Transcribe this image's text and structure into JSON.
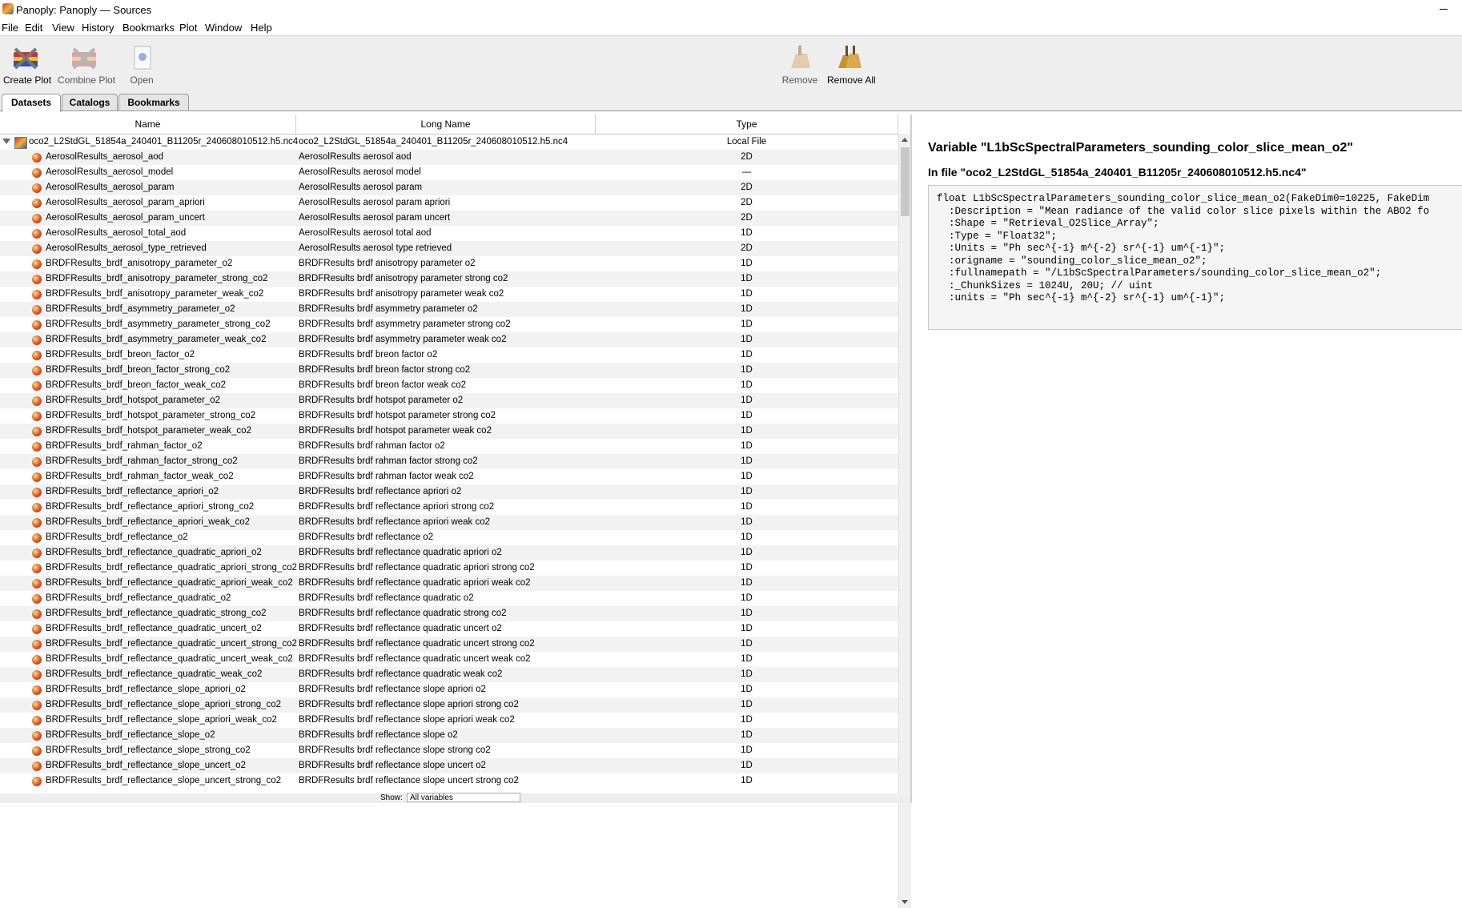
{
  "window": {
    "title": "Panoply: Panoply — Sources"
  },
  "menu": [
    "File",
    "Edit",
    "View",
    "History",
    "Bookmarks",
    "Plot",
    "Window",
    "Help"
  ],
  "toolbar": {
    "create_plot": "Create Plot",
    "combine_plot": "Combine Plot",
    "open": "Open",
    "remove": "Remove",
    "remove_all": "Remove All"
  },
  "tabs": [
    "Datasets",
    "Catalogs",
    "Bookmarks"
  ],
  "table": {
    "headers": [
      "Name",
      "Long Name",
      "Type"
    ],
    "root": {
      "name": "oco2_L2StdGL_51854a_240401_B11205r_240608010512.h5.nc4",
      "long_name": "oco2_L2StdGL_51854a_240401_B11205r_240608010512.h5.nc4",
      "type": "Local File"
    },
    "rows": [
      {
        "name": "AerosolResults_aerosol_aod",
        "long_name": "AerosolResults aerosol aod",
        "type": "2D"
      },
      {
        "name": "AerosolResults_aerosol_model",
        "long_name": "AerosolResults aerosol model",
        "type": "—"
      },
      {
        "name": "AerosolResults_aerosol_param",
        "long_name": "AerosolResults aerosol param",
        "type": "2D"
      },
      {
        "name": "AerosolResults_aerosol_param_apriori",
        "long_name": "AerosolResults aerosol param apriori",
        "type": "2D"
      },
      {
        "name": "AerosolResults_aerosol_param_uncert",
        "long_name": "AerosolResults aerosol param uncert",
        "type": "2D"
      },
      {
        "name": "AerosolResults_aerosol_total_aod",
        "long_name": "AerosolResults aerosol total aod",
        "type": "1D"
      },
      {
        "name": "AerosolResults_aerosol_type_retrieved",
        "long_name": "AerosolResults aerosol type retrieved",
        "type": "2D"
      },
      {
        "name": "BRDFResults_brdf_anisotropy_parameter_o2",
        "long_name": "BRDFResults brdf anisotropy parameter o2",
        "type": "1D"
      },
      {
        "name": "BRDFResults_brdf_anisotropy_parameter_strong_co2",
        "long_name": "BRDFResults brdf anisotropy parameter strong co2",
        "type": "1D"
      },
      {
        "name": "BRDFResults_brdf_anisotropy_parameter_weak_co2",
        "long_name": "BRDFResults brdf anisotropy parameter weak co2",
        "type": "1D"
      },
      {
        "name": "BRDFResults_brdf_asymmetry_parameter_o2",
        "long_name": "BRDFResults brdf asymmetry parameter o2",
        "type": "1D"
      },
      {
        "name": "BRDFResults_brdf_asymmetry_parameter_strong_co2",
        "long_name": "BRDFResults brdf asymmetry parameter strong co2",
        "type": "1D"
      },
      {
        "name": "BRDFResults_brdf_asymmetry_parameter_weak_co2",
        "long_name": "BRDFResults brdf asymmetry parameter weak co2",
        "type": "1D"
      },
      {
        "name": "BRDFResults_brdf_breon_factor_o2",
        "long_name": "BRDFResults brdf breon factor o2",
        "type": "1D"
      },
      {
        "name": "BRDFResults_brdf_breon_factor_strong_co2",
        "long_name": "BRDFResults brdf breon factor strong co2",
        "type": "1D"
      },
      {
        "name": "BRDFResults_brdf_breon_factor_weak_co2",
        "long_name": "BRDFResults brdf breon factor weak co2",
        "type": "1D"
      },
      {
        "name": "BRDFResults_brdf_hotspot_parameter_o2",
        "long_name": "BRDFResults brdf hotspot parameter o2",
        "type": "1D"
      },
      {
        "name": "BRDFResults_brdf_hotspot_parameter_strong_co2",
        "long_name": "BRDFResults brdf hotspot parameter strong co2",
        "type": "1D"
      },
      {
        "name": "BRDFResults_brdf_hotspot_parameter_weak_co2",
        "long_name": "BRDFResults brdf hotspot parameter weak co2",
        "type": "1D"
      },
      {
        "name": "BRDFResults_brdf_rahman_factor_o2",
        "long_name": "BRDFResults brdf rahman factor o2",
        "type": "1D"
      },
      {
        "name": "BRDFResults_brdf_rahman_factor_strong_co2",
        "long_name": "BRDFResults brdf rahman factor strong co2",
        "type": "1D"
      },
      {
        "name": "BRDFResults_brdf_rahman_factor_weak_co2",
        "long_name": "BRDFResults brdf rahman factor weak co2",
        "type": "1D"
      },
      {
        "name": "BRDFResults_brdf_reflectance_apriori_o2",
        "long_name": "BRDFResults brdf reflectance apriori o2",
        "type": "1D"
      },
      {
        "name": "BRDFResults_brdf_reflectance_apriori_strong_co2",
        "long_name": "BRDFResults brdf reflectance apriori strong co2",
        "type": "1D"
      },
      {
        "name": "BRDFResults_brdf_reflectance_apriori_weak_co2",
        "long_name": "BRDFResults brdf reflectance apriori weak co2",
        "type": "1D"
      },
      {
        "name": "BRDFResults_brdf_reflectance_o2",
        "long_name": "BRDFResults brdf reflectance o2",
        "type": "1D"
      },
      {
        "name": "BRDFResults_brdf_reflectance_quadratic_apriori_o2",
        "long_name": "BRDFResults brdf reflectance quadratic apriori o2",
        "type": "1D"
      },
      {
        "name": "BRDFResults_brdf_reflectance_quadratic_apriori_strong_co2",
        "long_name": "BRDFResults brdf reflectance quadratic apriori strong co2",
        "type": "1D"
      },
      {
        "name": "BRDFResults_brdf_reflectance_quadratic_apriori_weak_co2",
        "long_name": "BRDFResults brdf reflectance quadratic apriori weak co2",
        "type": "1D"
      },
      {
        "name": "BRDFResults_brdf_reflectance_quadratic_o2",
        "long_name": "BRDFResults brdf reflectance quadratic o2",
        "type": "1D"
      },
      {
        "name": "BRDFResults_brdf_reflectance_quadratic_strong_co2",
        "long_name": "BRDFResults brdf reflectance quadratic strong co2",
        "type": "1D"
      },
      {
        "name": "BRDFResults_brdf_reflectance_quadratic_uncert_o2",
        "long_name": "BRDFResults brdf reflectance quadratic uncert o2",
        "type": "1D"
      },
      {
        "name": "BRDFResults_brdf_reflectance_quadratic_uncert_strong_co2",
        "long_name": "BRDFResults brdf reflectance quadratic uncert strong co2",
        "type": "1D"
      },
      {
        "name": "BRDFResults_brdf_reflectance_quadratic_uncert_weak_co2",
        "long_name": "BRDFResults brdf reflectance quadratic uncert weak co2",
        "type": "1D"
      },
      {
        "name": "BRDFResults_brdf_reflectance_quadratic_weak_co2",
        "long_name": "BRDFResults brdf reflectance quadratic weak co2",
        "type": "1D"
      },
      {
        "name": "BRDFResults_brdf_reflectance_slope_apriori_o2",
        "long_name": "BRDFResults brdf reflectance slope apriori o2",
        "type": "1D"
      },
      {
        "name": "BRDFResults_brdf_reflectance_slope_apriori_strong_co2",
        "long_name": "BRDFResults brdf reflectance slope apriori strong co2",
        "type": "1D"
      },
      {
        "name": "BRDFResults_brdf_reflectance_slope_apriori_weak_co2",
        "long_name": "BRDFResults brdf reflectance slope apriori weak co2",
        "type": "1D"
      },
      {
        "name": "BRDFResults_brdf_reflectance_slope_o2",
        "long_name": "BRDFResults brdf reflectance slope o2",
        "type": "1D"
      },
      {
        "name": "BRDFResults_brdf_reflectance_slope_strong_co2",
        "long_name": "BRDFResults brdf reflectance slope strong co2",
        "type": "1D"
      },
      {
        "name": "BRDFResults_brdf_reflectance_slope_uncert_o2",
        "long_name": "BRDFResults brdf reflectance slope uncert o2",
        "type": "1D"
      },
      {
        "name": "BRDFResults_brdf_reflectance_slope_uncert_strong_co2",
        "long_name": "BRDFResults brdf reflectance slope uncert strong co2",
        "type": "1D"
      }
    ]
  },
  "footer": {
    "show_label": "Show:",
    "show_value": "All variables"
  },
  "detail": {
    "variable_title": "Variable \"L1bScSpectralParameters_sounding_color_slice_mean_o2\"",
    "file_title": "In file \"oco2_L2StdGL_51854a_240401_B11205r_240608010512.h5.nc4\"",
    "cdl_lines": [
      "float L1bScSpectralParameters_sounding_color_slice_mean_o2(FakeDim0=10225, FakeDim",
      "  :Description = \"Mean radiance of the valid color slice pixels within the ABO2 fo",
      "  :Shape = \"Retrieval_O2Slice_Array\";",
      "  :Type = \"Float32\";",
      "  :Units = \"Ph sec^{-1} m^{-2} sr^{-1} um^{-1}\";",
      "  :origname = \"sounding_color_slice_mean_o2\";",
      "  :fullnamepath = \"/L1bScSpectralParameters/sounding_color_slice_mean_o2\";",
      "  :_ChunkSizes = 1024U, 20U; // uint",
      "  :units = \"Ph sec^{-1} m^{-2} sr^{-1} um^{-1}\";"
    ]
  }
}
